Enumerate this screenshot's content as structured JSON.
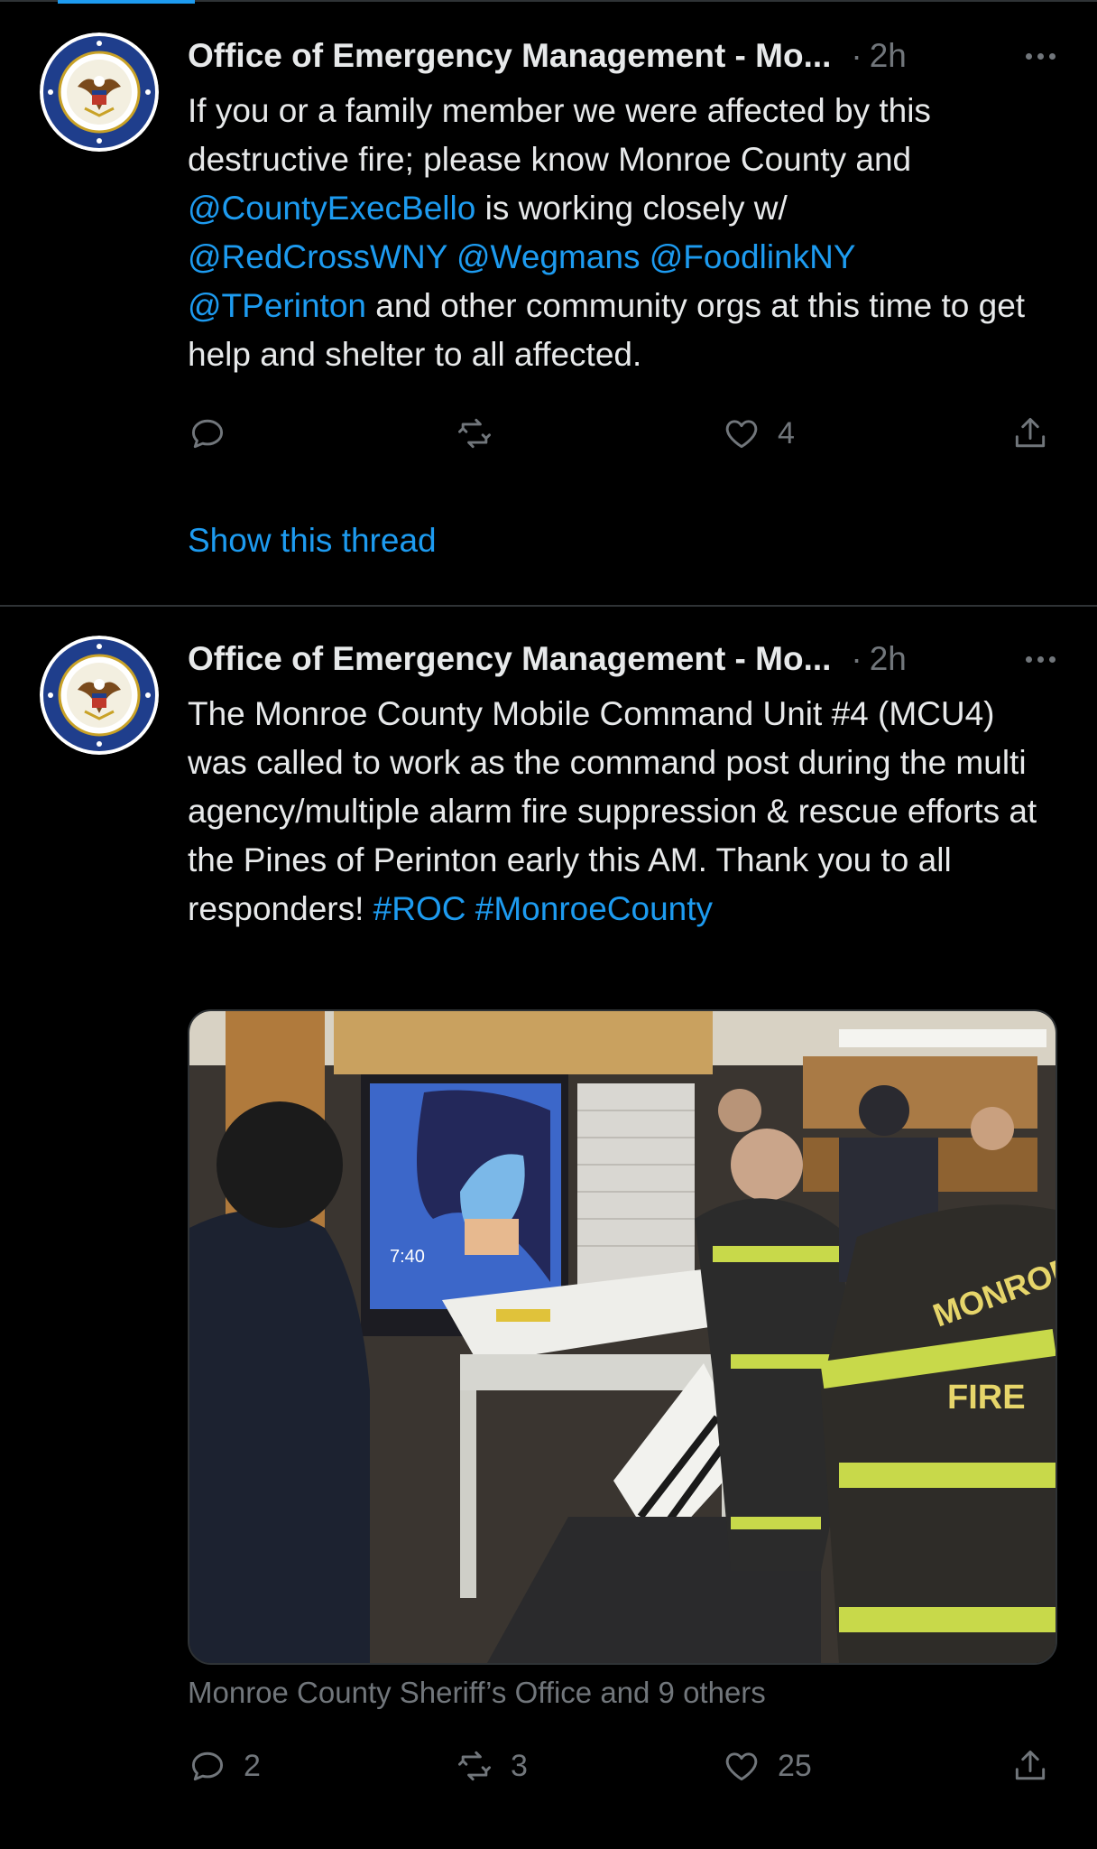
{
  "tweets": [
    {
      "author": "Office of Emergency Management - Mo...",
      "time": "2h",
      "segments": [
        {
          "text": "If you or a family member we were affected by this destructive fire; please know Monroe County and ",
          "link": false
        },
        {
          "text": "@CountyExecBello",
          "link": true
        },
        {
          "text": " is working closely w/ ",
          "link": false
        },
        {
          "text": "@RedCrossWNY",
          "link": true
        },
        {
          "text": " ",
          "link": false
        },
        {
          "text": "@Wegmans",
          "link": true
        },
        {
          "text": " ",
          "link": false
        },
        {
          "text": "@FoodlinkNY",
          "link": true
        },
        {
          "text": " ",
          "link": false
        },
        {
          "text": "@TPerinton",
          "link": true
        },
        {
          "text": " and other community orgs at this time to get help and shelter to all affected.",
          "link": false
        }
      ],
      "actions": {
        "reply": "",
        "retweet": "",
        "like": "4"
      },
      "show_thread": "Show this thread"
    },
    {
      "author": "Office of Emergency Management - Mo...",
      "time": "2h",
      "segments": [
        {
          "text": "The Monroe County Mobile Command Unit #4 (MCU4) was called to work as the command post during the multi agency/multiple alarm fire suppression & rescue efforts at the Pines of Perinton early this AM. Thank you to all responders! ",
          "link": false
        },
        {
          "text": "#ROC",
          "link": true
        },
        {
          "text": " ",
          "link": false
        },
        {
          "text": "#MonroeCounty",
          "link": true
        }
      ],
      "photo": {
        "screen_time": "7:40",
        "jacket_text_1": "MONROE",
        "jacket_text_2": "FIRE"
      },
      "tagged": "Monroe County Sheriff’s Office and 9 others",
      "actions": {
        "reply": "2",
        "retweet": "3",
        "like": "25"
      }
    }
  ],
  "colors": {
    "accent": "#1d9bf0",
    "muted": "#71767b",
    "text": "#e7e9ea",
    "background": "#000000"
  },
  "icons": [
    "reply-icon",
    "retweet-icon",
    "like-icon",
    "share-icon",
    "more-icon"
  ]
}
